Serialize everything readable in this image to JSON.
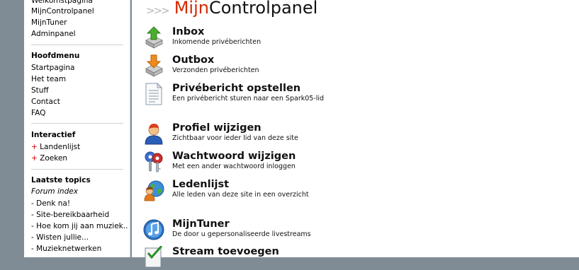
{
  "sidebar": {
    "top_links": [
      "Welkomstpagina",
      "MijnControlpanel",
      "MijnTuner",
      "Adminpanel"
    ],
    "hoofdmenu": {
      "title": "Hoofdmenu",
      "items": [
        "Startpagina",
        "Het team",
        "Stuff",
        "Contact",
        "FAQ"
      ]
    },
    "interactief": {
      "title": "Interactief",
      "items": [
        "Landenlijst",
        "Zoeken"
      ],
      "marker": "+"
    },
    "topics": {
      "title": "Laatste topics",
      "index_label": "Forum index",
      "items": [
        "- Denk na!",
        "- Site-bereikbaarheid",
        "- Hoe kom jij aan muziek..",
        "- Wisten jullie...",
        "- Muzieknetwerken"
      ]
    }
  },
  "main": {
    "title_prefix": "Mijn",
    "title_suffix": "Controlpanel",
    "title_arrows": ">>>",
    "items": [
      {
        "title": "Inbox",
        "subtitle": "Inkomende privéberichten",
        "icon": "inbox-icon"
      },
      {
        "title": "Outbox",
        "subtitle": "Verzonden privéberichten",
        "icon": "outbox-icon"
      },
      {
        "title": "Privébericht opstellen",
        "subtitle": "Een privébericht sturen naar een Spark05-lid",
        "icon": "document-icon"
      },
      {
        "title": "Profiel wijzigen",
        "subtitle": "Zichtbaar voor ieder lid van deze site",
        "icon": "user-icon"
      },
      {
        "title": "Wachtwoord wijzigen",
        "subtitle": "Met een ander wachtwoord inloggen",
        "icon": "keys-icon"
      },
      {
        "title": "Ledenlijst",
        "subtitle": "Alle leden van deze site in een overzicht",
        "icon": "members-globe-icon"
      },
      {
        "title": "MijnTuner",
        "subtitle": "De door u gepersonaliseerde livestreams",
        "icon": "music-note-icon"
      },
      {
        "title": "Stream toevoegen",
        "subtitle": "",
        "icon": "checklist-icon"
      }
    ]
  },
  "colors": {
    "background": "#7f8c96",
    "title_accent": "#d42a00",
    "plus_marker": "#d40000"
  }
}
